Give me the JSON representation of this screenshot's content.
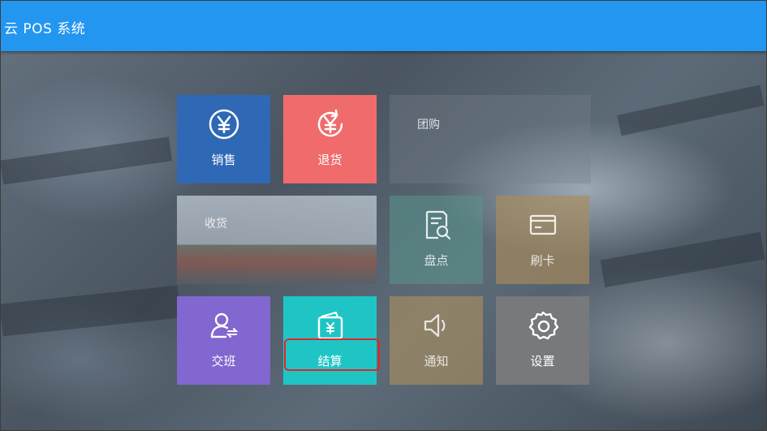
{
  "app": {
    "title": "云 POS 系统"
  },
  "tiles": {
    "sale": {
      "label": "销售",
      "icon": "yen-circle-icon",
      "color": "#2f69b5"
    },
    "return": {
      "label": "退货",
      "icon": "yen-refund-icon",
      "color": "#f06b6b"
    },
    "group": {
      "label": "团购"
    },
    "receive": {
      "label": "收货"
    },
    "stocktake": {
      "label": "盘点",
      "icon": "document-search-icon"
    },
    "card": {
      "label": "刷卡",
      "icon": "card-icon"
    },
    "shift": {
      "label": "交班",
      "icon": "user-switch-icon",
      "color": "#8167cf"
    },
    "settle": {
      "label": "结算",
      "icon": "wallet-yen-icon",
      "color": "#1fc5c5"
    },
    "notify": {
      "label": "通知",
      "icon": "speaker-icon"
    },
    "settings": {
      "label": "设置",
      "icon": "gear-icon",
      "color": "#77797c"
    }
  },
  "highlight": {
    "color": "#e0262a"
  },
  "colors": {
    "appbar": "#2396f0"
  }
}
